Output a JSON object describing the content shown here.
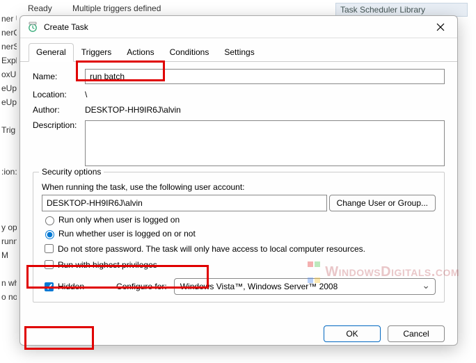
{
  "background": {
    "library_header": "Task Scheduler Library",
    "top_status": "Ready",
    "top_trigger": "Multiple triggers defined",
    "left_items": [
      "ner Up...",
      "nerCre",
      "nerSk",
      "Explor",
      "oxUp",
      "eUpd",
      "eUpd",
      "",
      "Trig",
      "",
      "",
      ":ion:",
      "",
      "",
      "",
      "y opt",
      "runn",
      "M",
      "",
      "n wh",
      "o not store password.  The task will only have access to local resources"
    ]
  },
  "dialog": {
    "title": "Create Task",
    "tabs": [
      "General",
      "Triggers",
      "Actions",
      "Conditions",
      "Settings"
    ],
    "active_tab": 0,
    "labels": {
      "name": "Name:",
      "location": "Location:",
      "author": "Author:",
      "description": "Description:"
    },
    "values": {
      "name": "run batch",
      "location": "\\",
      "author": "DESKTOP-HH9IR6J\\alvin",
      "description": ""
    },
    "security": {
      "legend": "Security options",
      "when_running": "When running the task, use the following user account:",
      "account": "DESKTOP-HH9IR6J\\alvin",
      "change_user": "Change User or Group...",
      "run_logged_on": "Run only when user is logged on",
      "run_whether": "Run whether user is logged on or not",
      "no_store_pw": "Do not store password.  The task will only have access to local computer resources.",
      "highest_priv": "Run with highest privileges",
      "hidden": "Hidden",
      "selected_run": "whether",
      "no_store_pw_checked": false,
      "highest_priv_checked": false,
      "hidden_checked": true
    },
    "configure_for_label": "Configure for:",
    "configure_for_value": "Windows Vista™, Windows Server™ 2008",
    "buttons": {
      "ok": "OK",
      "cancel": "Cancel"
    }
  },
  "watermark": "WindowsDigitals.com"
}
